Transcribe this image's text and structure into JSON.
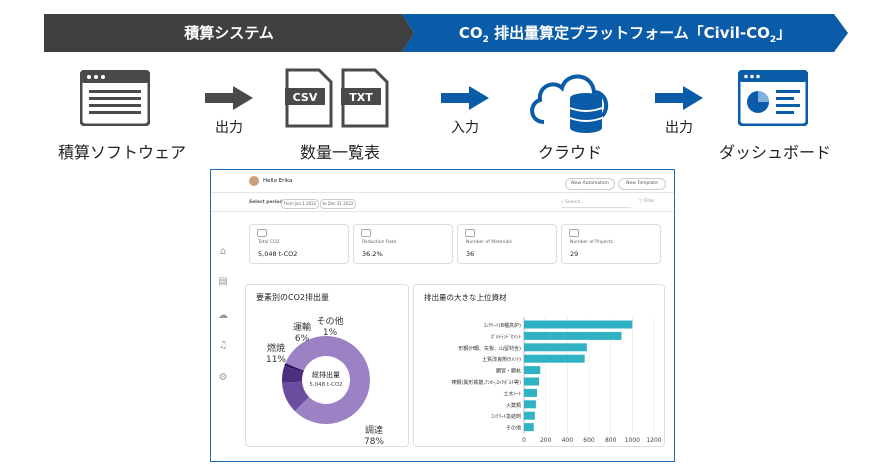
{
  "banner": {
    "left_text": "積算システム",
    "right_text_prefix": "CO",
    "right_text_sub": "2",
    "right_text_middle": " 排出量算定プラットフォーム「Civil-CO",
    "right_text_sub2": "2",
    "right_text_suffix": "」"
  },
  "flow": {
    "steps": [
      {
        "label": "積算ソフトウェア",
        "icon": "browser-window-icon"
      },
      {
        "label": "数量一覧表",
        "icon": "csv-txt-file-icon",
        "file1": "CSV",
        "file2": "TXT"
      },
      {
        "label": "クラウド",
        "icon": "cloud-database-icon"
      },
      {
        "label": "ダッシュボード",
        "icon": "dashboard-icon"
      }
    ],
    "arrows": [
      "出力",
      "入力",
      "出力"
    ]
  },
  "dashboard": {
    "greeting": "Hello Erika",
    "buttons": {
      "automation": "New Automation",
      "template": "New Template"
    },
    "filter": {
      "label": "Select period",
      "from": "From Jan 1 2022",
      "to": "to Dec 31 2022",
      "search_placeholder": "Search...",
      "filter_label": "Filter"
    },
    "cards": [
      {
        "label": "Total CO2",
        "value": "5,048  t-CO2"
      },
      {
        "label": "Reduction Rate",
        "value": "36.2%"
      },
      {
        "label": "Number of Materials",
        "value": "36"
      },
      {
        "label": "Number of Projects",
        "value": "29"
      }
    ],
    "pie_panel": {
      "title": "要素別のCO2排出量",
      "center_title": "総排出量",
      "center_value": "5,048 t-CO2"
    },
    "bar_panel": {
      "title": "排出量の大きな上位資材"
    }
  },
  "chart_data": [
    {
      "type": "pie",
      "title": "要素別のCO2排出量",
      "slices": [
        {
          "name": "調達",
          "value": 78,
          "pct_label": "78%",
          "color": "#9b82c4"
        },
        {
          "name": "燃焼",
          "value": 11,
          "pct_label": "11%",
          "color": "#6a4d9e"
        },
        {
          "name": "運輸",
          "value": 6,
          "pct_label": "6%",
          "color": "#4a2f7e"
        },
        {
          "name": "その他",
          "value": 1,
          "pct_label": "1%",
          "color": "#2e1a5c"
        }
      ]
    },
    {
      "type": "bar",
      "orientation": "horizontal",
      "title": "排出量の大きな上位資材",
      "categories": [
        "ｺﾝｸﾘｰﾄ(B種高炉)",
        "ﾎﾟﾙﾄﾗﾝﾄﾞｾﾒﾝﾄ",
        "形鋼(H鋼、矢板、山留材含)",
        "土質改良剤(ｾﾒﾝﾄ)",
        "鋼管・鋼杭",
        "棒鋼(異形鉄筋,ｱﾝｶｰ,ﾛｯｸﾎﾞﾙﾄ等)",
        "土木ｼｰﾄ",
        "火薬類",
        "ｺﾝｸﾘｰﾄ急結剤",
        "その他"
      ],
      "values": [
        1000,
        900,
        580,
        560,
        150,
        140,
        120,
        110,
        100,
        90
      ],
      "xticks": [
        "0",
        "200",
        "400",
        "600",
        "800",
        "1000",
        "1200"
      ],
      "xlim": [
        0,
        1200
      ],
      "color": "#2fb3c4"
    }
  ]
}
